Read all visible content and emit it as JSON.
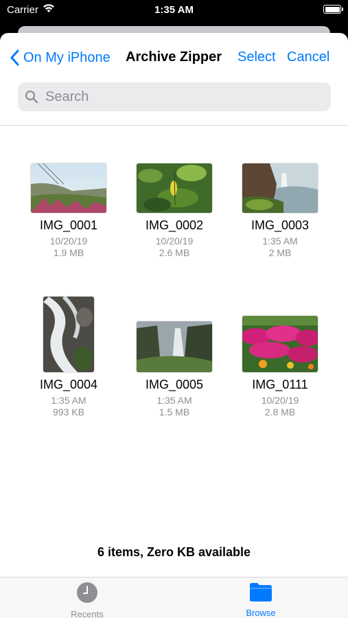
{
  "status_bar": {
    "carrier": "Carrier",
    "time": "1:35 AM"
  },
  "nav": {
    "back_label": "On My iPhone",
    "title": "Archive Zipper",
    "select_label": "Select",
    "cancel_label": "Cancel"
  },
  "search": {
    "placeholder": "Search"
  },
  "files": [
    {
      "name": "IMG_0001",
      "date": "10/20/19",
      "size": "1.9 MB"
    },
    {
      "name": "IMG_0002",
      "date": "10/20/19",
      "size": "2.6 MB"
    },
    {
      "name": "IMG_0003",
      "date": "1:35 AM",
      "size": "2 MB"
    },
    {
      "name": "IMG_0004",
      "date": "1:35 AM",
      "size": "993 KB"
    },
    {
      "name": "IMG_0005",
      "date": "1:35 AM",
      "size": "1.5 MB"
    },
    {
      "name": "IMG_0111",
      "date": "10/20/19",
      "size": "2.8 MB"
    }
  ],
  "footer": {
    "summary": "6 items, Zero KB available"
  },
  "tabs": [
    {
      "label": "Recents",
      "icon": "clock-icon"
    },
    {
      "label": "Browse",
      "icon": "folder-icon"
    }
  ],
  "colors": {
    "accent": "#007aff",
    "secondary_text": "#8e8e93"
  }
}
